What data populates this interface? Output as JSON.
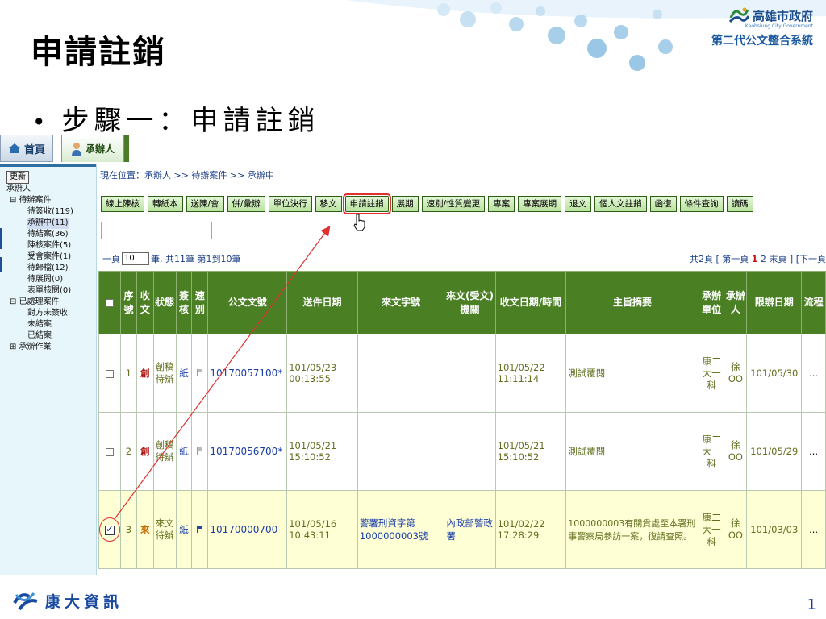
{
  "slide": {
    "title": "申請註銷",
    "bullet": "步驟一：申請註銷",
    "page_number": "1",
    "footer_company": "康大資訊"
  },
  "brand": {
    "name": "高雄市政府",
    "subtitle": "Kaohsiung City Government",
    "system": "第二代公文整合系統"
  },
  "app": {
    "nav": {
      "home": "首頁",
      "user": "承辦人"
    },
    "sidebar": {
      "refresh": "更新",
      "root": "承辦人",
      "items": [
        {
          "label": "⊟ 待辦案件",
          "level": 1
        },
        {
          "label": "待簽收(119)",
          "level": 2
        },
        {
          "label": "承辦中(11)",
          "level": 2,
          "selected": true
        },
        {
          "label": "待結案(36)",
          "level": 2
        },
        {
          "label": "陳核案件(5)",
          "level": 2
        },
        {
          "label": "受會案件(1)",
          "level": 2
        },
        {
          "label": "待歸檔(12)",
          "level": 2
        },
        {
          "label": "待展閱(0)",
          "level": 2
        },
        {
          "label": "表單核閱(0)",
          "level": 2
        },
        {
          "label": "⊟ 已處理案件",
          "level": 1
        },
        {
          "label": "對方未簽收",
          "level": 2
        },
        {
          "label": "未結案",
          "level": 2
        },
        {
          "label": "已結案",
          "level": 2
        },
        {
          "label": "⊞ 承辦作業",
          "level": 1
        }
      ]
    },
    "breadcrumb": "現在位置：承辦人 >> 待辦案件 >> 承辦中",
    "toolbar": [
      "線上陳核",
      "轉紙本",
      "送陳/會",
      "併/彙辦",
      "單位決行",
      "移文",
      "申請註銷",
      "展期",
      "速別/性質變更",
      "專案",
      "專案展期",
      "退文",
      "個人文註銷",
      "函復",
      "條件查詢",
      "讀碼"
    ],
    "pager": {
      "prefix": "一頁",
      "page_size": "10",
      "summary": "筆, 共11筆 第1到10筆",
      "right_a": "共2頁 [ 第一頁 ",
      "current": "1",
      "right_b": " 2 末頁 ] [下一頁"
    },
    "table": {
      "headers": [
        "序號",
        "收文",
        "狀態",
        "簽核",
        "速別",
        "公文文號",
        "送件日期",
        "來文字號",
        "來文(受文)機關",
        "收文日期/時間",
        "主旨摘要",
        "承辦單位",
        "承辦人",
        "限辦日期",
        "流程"
      ],
      "rows": [
        {
          "no": "1",
          "recv": "創",
          "status": "創稿待辦",
          "sign": "紙",
          "doc_no": "10170057100*",
          "sent_date": "101/05/23",
          "sent_time": "00:13:55",
          "ref_no": "",
          "agency": "",
          "recv_date": "101/05/22",
          "recv_time": "11:11:14",
          "subject": "測試覆閱",
          "unit": "康二大一科",
          "handler": "徐OO",
          "due": "101/05/30",
          "flow": "...",
          "checked": false
        },
        {
          "no": "2",
          "recv": "創",
          "status": "創稿待辦",
          "sign": "紙",
          "doc_no": "10170056700*",
          "sent_date": "101/05/21",
          "sent_time": "15:10:52",
          "ref_no": "",
          "agency": "",
          "recv_date": "101/05/21",
          "recv_time": "15:10:52",
          "subject": "測試覆閱",
          "unit": "康二大一科",
          "handler": "徐OO",
          "due": "101/05/29",
          "flow": "...",
          "checked": false
        },
        {
          "no": "3",
          "recv": "來",
          "status": "來文待辦",
          "sign": "紙",
          "doc_no": "10170000700",
          "sent_date": "101/05/16",
          "sent_time": "10:43:11",
          "ref_no": "警署刑資字第1000000003號",
          "agency": "內政部警政署",
          "recv_date": "101/02/22",
          "recv_time": "17:28:29",
          "subject": "1000000003有關貴處至本署刑事警察局參訪一案，復請查照。",
          "unit": "康二大一科",
          "handler": "徐OO",
          "due": "101/03/03",
          "flow": "...",
          "checked": true
        }
      ]
    }
  },
  "colors": {
    "header_green": "#4a7f24",
    "accent_blue": "#1a4aa0",
    "annotation_red": "#e03030",
    "selected_row": "#ffffd6"
  }
}
